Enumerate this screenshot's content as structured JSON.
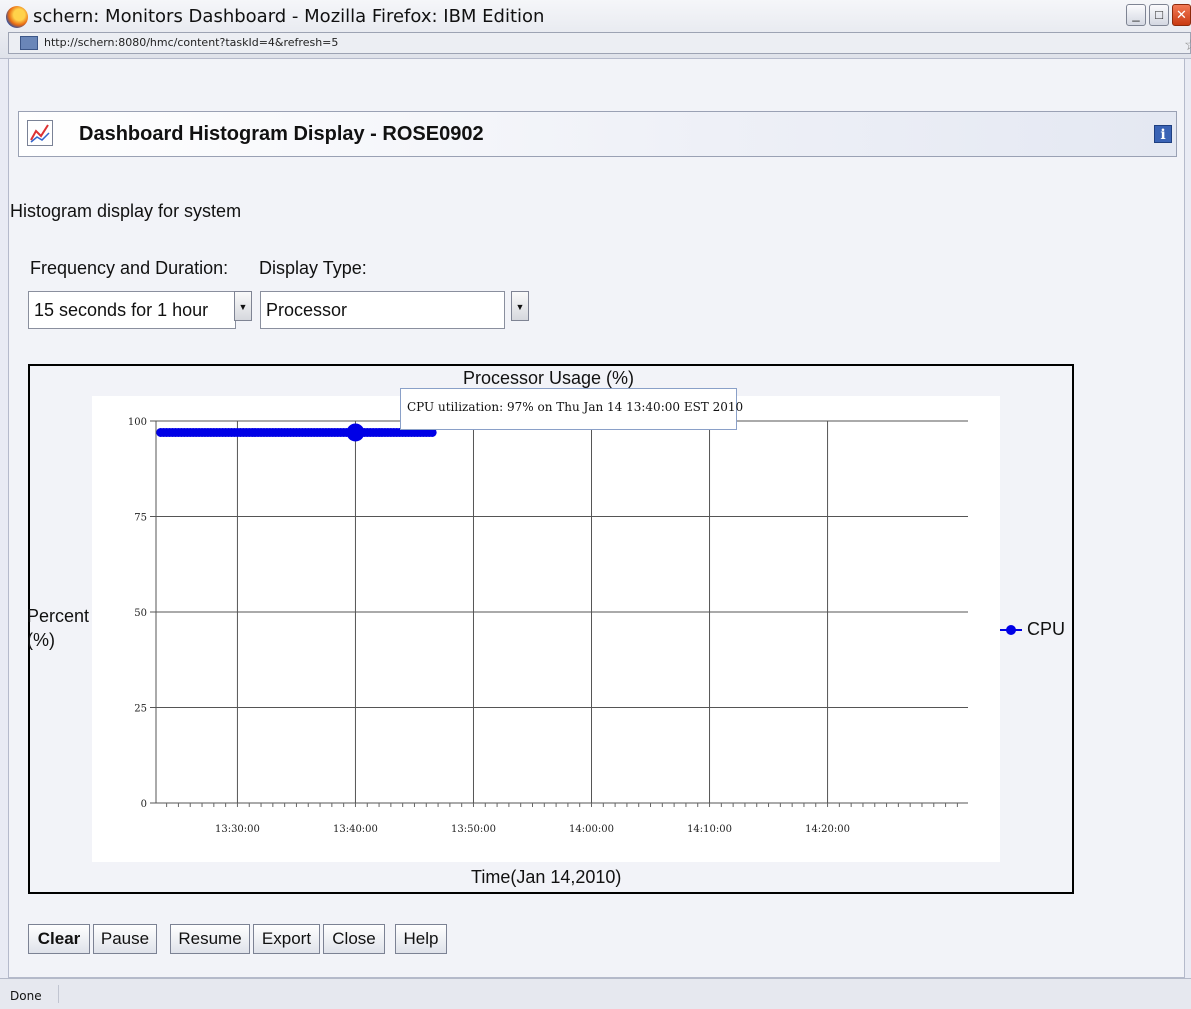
{
  "window": {
    "title": "schern: Monitors Dashboard - Mozilla Firefox: IBM Edition",
    "url": "http://schern:8080/hmc/content?taskId=4&refresh=5"
  },
  "header": {
    "title": "Dashboard Histogram Display - ROSE0902",
    "info_icon": "i"
  },
  "page": {
    "subtitle": "Histogram display for system",
    "frequency_label": "Frequency and Duration:",
    "frequency_value": "15 seconds for 1 hour",
    "display_type_label": "Display Type:",
    "display_type_value": "Processor"
  },
  "chart_data": {
    "type": "line",
    "title": "Processor Usage (%)",
    "xlabel": "Time(Jan 14,2010)",
    "ylabel_lines": [
      "Percent",
      "(%)"
    ],
    "x_ticks": [
      "13:30:00",
      "13:40:00",
      "13:50:00",
      "14:00:00",
      "14:10:00",
      "14:20:00"
    ],
    "y_ticks": [
      0,
      25,
      50,
      75,
      100
    ],
    "ylim": [
      0,
      100
    ],
    "x_range_minutes": [
      13.1,
      81.9
    ],
    "grid": true,
    "legend_position": "right",
    "series": [
      {
        "name": "CPU",
        "color": "#0000e6",
        "x_start_minutes": 13.5,
        "x_end_minutes": 36.5,
        "interval_seconds": 15,
        "y": 97,
        "highlight": {
          "x_minutes": 30,
          "y": 97
        }
      }
    ],
    "tooltip": "CPU utilization: 97% on Thu Jan 14 13:40:00 EST 2010"
  },
  "buttons": [
    "Clear",
    "Pause",
    "Resume",
    "Export",
    "Close",
    "Help"
  ],
  "status": "Done"
}
